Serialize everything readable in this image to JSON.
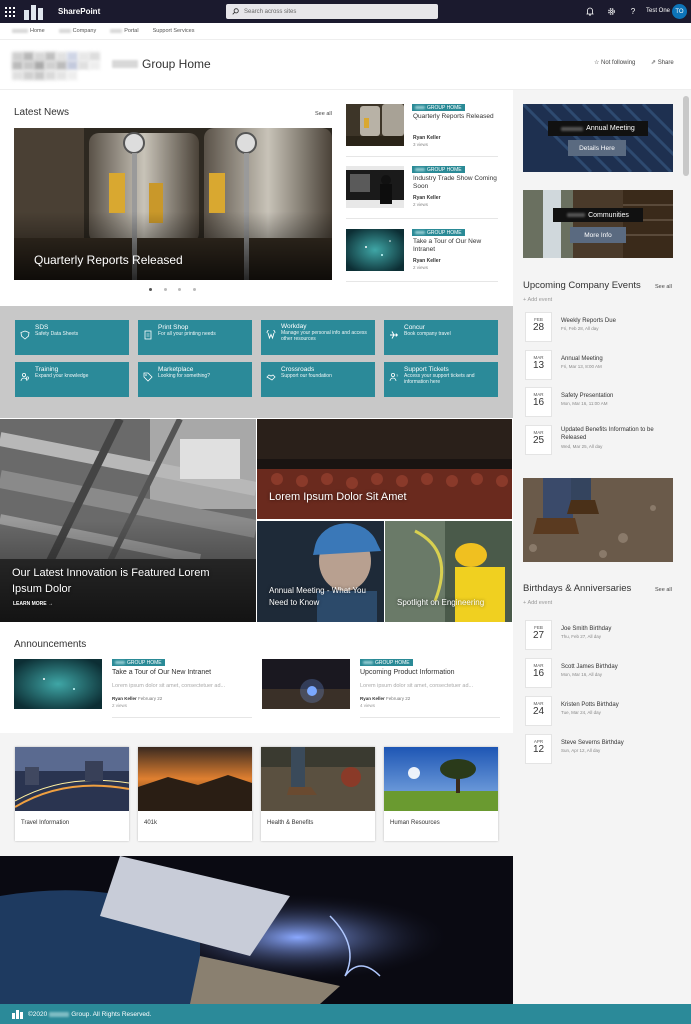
{
  "suite_bar": {
    "app_name": "SharePoint",
    "search_placeholder": "Search across sites",
    "user_name": "Test One",
    "user_initials": "TO",
    "bg_color": "#1b1a2e",
    "icons": [
      "waffle-icon",
      "bell-icon",
      "gear-icon",
      "help-icon"
    ]
  },
  "hub_nav": {
    "items": [
      {
        "label": "Home"
      },
      {
        "label": "Company"
      },
      {
        "label": "Portal"
      },
      {
        "label": "Support Services"
      }
    ]
  },
  "site_header": {
    "title": "Group Home",
    "follow_label": "Not following",
    "share_label": "Share"
  },
  "news": {
    "title": "Latest News",
    "see_all": "See all",
    "hero": {
      "title": "Quarterly Reports Released"
    },
    "carousel": {
      "total": 4,
      "active": 1
    },
    "items": [
      {
        "badge": "GROUP HOME",
        "title": "Quarterly Reports Released",
        "author": "Ryan Keller",
        "views": "3 views"
      },
      {
        "badge": "GROUP HOME",
        "title": "Industry Trade Show Coming Soon",
        "author": "Ryan Keller",
        "views": "2 views"
      },
      {
        "badge": "GROUP HOME",
        "title": "Take a Tour of Our New Intranet",
        "author": "Ryan Keller",
        "views": "2 views"
      }
    ]
  },
  "quick_links": [
    {
      "title": "SDS",
      "desc": "Safety Data Sheets",
      "icon": "shield-icon"
    },
    {
      "title": "Print Shop",
      "desc": "For all your printing needs",
      "icon": "document-icon"
    },
    {
      "title": "Workday",
      "desc": "Manage your personal info and access other resources",
      "icon": "workday-icon"
    },
    {
      "title": "Concur",
      "desc": "Book company travel",
      "icon": "airplane-icon"
    },
    {
      "title": "Training",
      "desc": "Expand your knowledge",
      "icon": "people-icon"
    },
    {
      "title": "Marketplace",
      "desc": "Looking for something?",
      "icon": "tag-icon"
    },
    {
      "title": "Crossroads",
      "desc": "Support our foundation",
      "icon": "handshake-icon"
    },
    {
      "title": "Support Tickets",
      "desc": "Access your support tickets and information here",
      "icon": "person-help-icon"
    }
  ],
  "hero_grid": {
    "main": {
      "title": "Our Latest Innovation is Featured Lorem Ipsum Dolor",
      "link": "LEARN MORE"
    },
    "top_right": {
      "title": "Lorem Ipsum Dolor Sit Amet"
    },
    "bottom_mid": {
      "title": "Annual Meeting - What You Need to Know"
    },
    "bottom_right": {
      "title": "Spotlight on Engineering"
    }
  },
  "announcements": {
    "title": "Announcements",
    "items": [
      {
        "badge": "GROUP HOME",
        "title": "Take a Tour of Our New Intranet",
        "body": "Lorem ipsum dolor sit amet, consectetuer ad...",
        "author": "Ryan Keller",
        "date": "February 22",
        "views": "2 views"
      },
      {
        "badge": "GROUP HOME",
        "title": "Upcoming Product Information",
        "body": "Lorem ipsum dolor sit amet, consectetuer ad...",
        "author": "Ryan Keller",
        "date": "February 22",
        "views": "4 views"
      }
    ]
  },
  "cards": [
    {
      "title": "Travel Information"
    },
    {
      "title": "401k"
    },
    {
      "title": "Health & Benefits"
    },
    {
      "title": "Human Resources"
    }
  ],
  "right_col": {
    "annual_meeting": {
      "title": "Annual Meeting",
      "button": "Details Here"
    },
    "communities": {
      "title": "Communities",
      "button": "More Info"
    },
    "events": {
      "title": "Upcoming Company Events",
      "see_all": "See all",
      "add_label": "Add event",
      "items": [
        {
          "mon": "FEB",
          "day": "28",
          "title": "Weekly Reports Due",
          "sub": "Fri, Feb 28, All day"
        },
        {
          "mon": "MAR",
          "day": "13",
          "title": "Annual Meeting",
          "sub": "Fri, Mar 13, 8:00 AM"
        },
        {
          "mon": "MAR",
          "day": "16",
          "title": "Safety Presentation",
          "sub": "Mon, Mar 16, 11:00 AM"
        },
        {
          "mon": "MAR",
          "day": "25",
          "title": "Updated Benefits Information to be Released",
          "sub": "Wed, Mar 25, All day"
        }
      ]
    },
    "birthdays": {
      "title": "Birthdays & Anniversaries",
      "see_all": "See all",
      "add_label": "Add event",
      "items": [
        {
          "mon": "FEB",
          "day": "27",
          "title": "Joe Smith Birthday",
          "sub": "Thu, Feb 27, All day"
        },
        {
          "mon": "MAR",
          "day": "16",
          "title": "Scott James Birthday",
          "sub": "Mon, Mar 16, All day"
        },
        {
          "mon": "MAR",
          "day": "24",
          "title": "Kristen Potts Birthday",
          "sub": "Tue, Mar 24, All day"
        },
        {
          "mon": "APR",
          "day": "12",
          "title": "Steve Severns Birthday",
          "sub": "Sun, Apr 12, All day"
        }
      ]
    }
  },
  "footer": {
    "text": "Group. All Rights Reserved.",
    "year": "©2020"
  },
  "colors": {
    "accent": "#2b8a99",
    "suite_bar": "#1b1a2e",
    "quick_link_band": "#c8c8c8"
  }
}
